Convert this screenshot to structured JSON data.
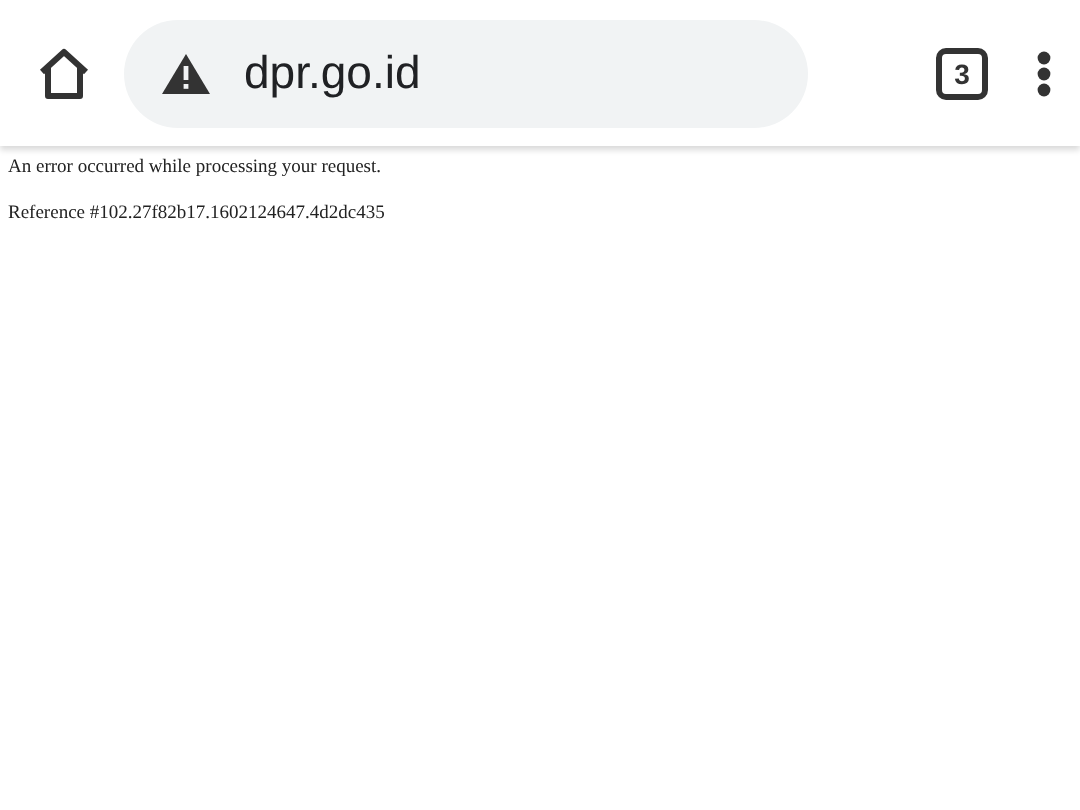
{
  "toolbar": {
    "url": "dpr.go.id",
    "tab_count": "3"
  },
  "page": {
    "lines": [
      "An error occurred while processing your request.",
      "Reference #102.27f82b17.1602124647.4d2dc435"
    ]
  }
}
